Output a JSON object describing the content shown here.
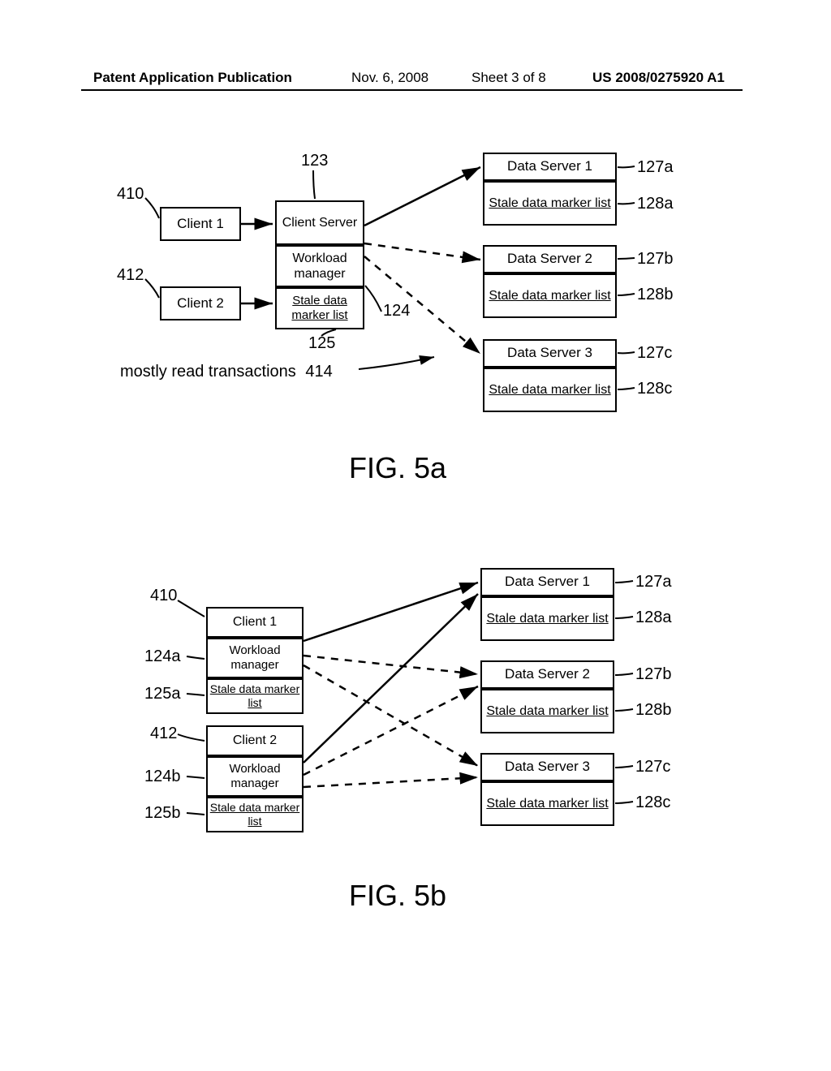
{
  "header": {
    "title": "Patent Application Publication",
    "date": "Nov. 6, 2008",
    "sheet": "Sheet 3 of 8",
    "pubnum": "US 2008/0275920 A1"
  },
  "fig5a": {
    "caption": "FIG. 5a",
    "client1": "Client 1",
    "client2": "Client 2",
    "clientserver_top": "Client Server",
    "workload_manager": "Workload manager",
    "stale_data_list": "Stale data marker list",
    "data_server_1": "Data Server 1",
    "data_server_2": "Data Server 2",
    "data_server_3": "Data Server 3",
    "note": "mostly read transactions",
    "refs": {
      "r123": "123",
      "r410": "410",
      "r412": "412",
      "r124": "124",
      "r125": "125",
      "r414": "414",
      "r127a": "127a",
      "r128a": "128a",
      "r127b": "127b",
      "r128b": "128b",
      "r127c": "127c",
      "r128c": "128c"
    }
  },
  "fig5b": {
    "caption": "FIG. 5b",
    "client1": "Client 1",
    "client2": "Client 2",
    "workload_manager": "Workload manager",
    "stale_data_list": "Stale data marker list",
    "data_server_1": "Data Server 1",
    "data_server_2": "Data Server 2",
    "data_server_3": "Data Server 3",
    "refs": {
      "r410": "410",
      "r124a": "124a",
      "r125a": "125a",
      "r412": "412",
      "r124b": "124b",
      "r125b": "125b",
      "r127a": "127a",
      "r128a": "128a",
      "r127b": "127b",
      "r128b": "128b",
      "r127c": "127c",
      "r128c": "128c"
    }
  }
}
